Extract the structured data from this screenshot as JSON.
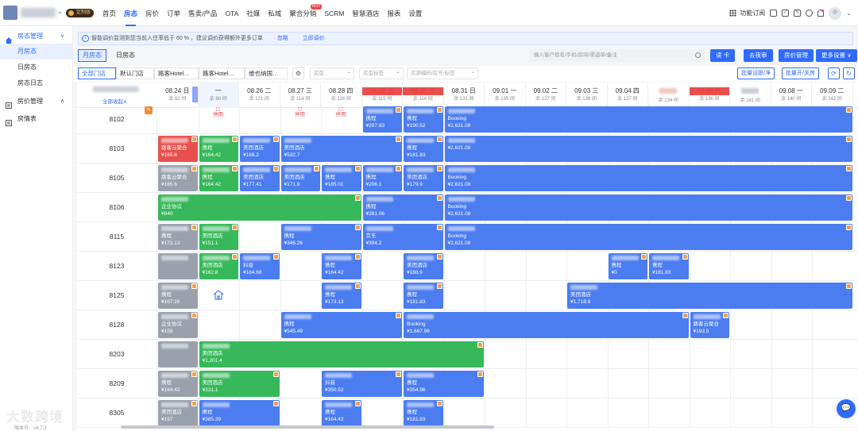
{
  "topbar": {
    "badge": "定制版",
    "nav": [
      {
        "label": "首页"
      },
      {
        "label": "房态",
        "active": true
      },
      {
        "label": "房价"
      },
      {
        "label": "订单"
      },
      {
        "label": "售卖/产品"
      },
      {
        "label": "OTA"
      },
      {
        "label": "社媒"
      },
      {
        "label": "私域"
      },
      {
        "label": "聚合分销",
        "hot": "HOT"
      },
      {
        "label": "SCRM"
      },
      {
        "label": "智慧酒店"
      },
      {
        "label": "报表"
      },
      {
        "label": "设置"
      }
    ],
    "subscribe": "功能订阅"
  },
  "sidebar": {
    "groups": [
      {
        "label": "房态管理",
        "caret": "∨",
        "icon": "home-icon",
        "items": [
          "月房态",
          "日房态",
          "房态日志"
        ],
        "active_item": 0
      },
      {
        "label": "房价管理",
        "caret": "∧",
        "icon": "price-icon",
        "items": []
      },
      {
        "label": "房情表",
        "caret": "",
        "icon": "report-icon",
        "items": []
      }
    ]
  },
  "notice": {
    "text": "智能调价监测到您当前入住率低于 60 % ，建议调价获得额外更多订单",
    "ignore": "忽略",
    "action": "立即调价"
  },
  "toolbar": {
    "view_tabs": [
      "月房态",
      "日房态"
    ],
    "search_placeholder": "输入客户姓名/手机/房间/渠道单/备注",
    "buttons": [
      "读 卡",
      "去夜审",
      "房价管理",
      "更多设置 ∨"
    ]
  },
  "filters": {
    "stores": [
      "全部门店",
      "默认门店",
      "路客Hotel…",
      "路客Hotel…",
      "维也纳国…"
    ],
    "selects": [
      "房型",
      "房型标签"
    ],
    "code_placeholder": "房源编码/房号/标签",
    "right_buttons": [
      "批量设脏/净",
      "批量开/关房"
    ]
  },
  "calendar": {
    "all_prop": "全部收起∧",
    "dates": [
      {
        "d": "08.24 日",
        "r": "余 82 间",
        "red": false
      },
      {
        "d": "一",
        "r": "余 88 间",
        "red": false,
        "today": true
      },
      {
        "d": "08.26 二",
        "r": "余 121 间",
        "red": false
      },
      {
        "d": "08.27 三",
        "r": "余 114 间",
        "red": false
      },
      {
        "d": "08.28 四",
        "r": "余 116 间",
        "red": false
      },
      {
        "d": "08.29 五",
        "r": "余 115 间",
        "red": true
      },
      {
        "d": "08.30 六",
        "r": "余 114 间",
        "red": true
      },
      {
        "d": "08.31 日",
        "r": "余 131 间",
        "red": false
      },
      {
        "d": "09.01 一",
        "r": "余 135 间",
        "red": false
      },
      {
        "d": "09.02 二",
        "r": "余 137 间",
        "red": false
      },
      {
        "d": "09.03 三",
        "r": "余 136 间",
        "red": false
      },
      {
        "d": "09.04 四",
        "r": "余 137 间",
        "red": false
      },
      {
        "d": "",
        "r": "余 134 间",
        "red": false,
        "blurred": true
      },
      {
        "d": "09.06 六",
        "r": "余 136 间",
        "red": true
      },
      {
        "d": "",
        "r": "余 141 间",
        "red": false,
        "blurred": true,
        "gray": true
      },
      {
        "d": "09.08 一",
        "r": "余 140 间",
        "red": false
      },
      {
        "d": "09.09 二",
        "r": "余 142 间",
        "red": false
      }
    ],
    "stop_label": "停用",
    "rows": [
      {
        "room": "8102",
        "stops": [
          1,
          3,
          4
        ],
        "bookings": [
          {
            "start": 5,
            "len": 1,
            "color": "blue",
            "ch": "携程",
            "pr": "¥207.93"
          },
          {
            "start": 6,
            "len": 1,
            "color": "blue",
            "ch": "携程",
            "pr": "¥190.52"
          },
          {
            "start": 7,
            "len": 10,
            "color": "blue",
            "ch": "Booking",
            "pr": "¥2,621.08"
          }
        ]
      },
      {
        "room": "8103",
        "bookings": [
          {
            "start": 0,
            "len": 1,
            "color": "red",
            "ch": "路客云聚合",
            "pr": "¥165.6"
          },
          {
            "start": 1,
            "len": 1,
            "color": "green",
            "ch": "携程",
            "pr": "¥164.42"
          },
          {
            "start": 2,
            "len": 1,
            "color": "blue",
            "ch": "美团酒店",
            "pr": "¥168.2"
          },
          {
            "start": 3,
            "len": 3,
            "color": "blue",
            "ch": "美团酒店",
            "pr": "¥532.7"
          },
          {
            "start": 6,
            "len": 1,
            "color": "blue",
            "ch": "携程",
            "pr": "¥181.83"
          },
          {
            "start": 7,
            "len": 10,
            "color": "blue",
            "ch": "",
            "pr": "¥2,621.08"
          }
        ]
      },
      {
        "room": "8105",
        "bookings": [
          {
            "start": 0,
            "len": 1,
            "color": "gray",
            "ch": "路客云聚合",
            "pr": "¥165.6"
          },
          {
            "start": 1,
            "len": 1,
            "color": "green",
            "ch": "携程",
            "pr": "¥164.42"
          },
          {
            "start": 2,
            "len": 1,
            "color": "blue",
            "ch": "美团酒店",
            "pr": "¥177.41"
          },
          {
            "start": 3,
            "len": 1,
            "color": "blue",
            "ch": "美团酒店",
            "pr": "¥171.8"
          },
          {
            "start": 4,
            "len": 1,
            "color": "blue",
            "ch": "携程",
            "pr": "¥185.01"
          },
          {
            "start": 5,
            "len": 1,
            "color": "blue",
            "ch": "携程",
            "pr": "¥206.1"
          },
          {
            "start": 6,
            "len": 1,
            "color": "blue",
            "ch": "美团酒店",
            "pr": "¥179.9"
          },
          {
            "start": 7,
            "len": 10,
            "color": "blue",
            "ch": "Booking",
            "pr": "¥2,621.08"
          }
        ]
      },
      {
        "room": "8106",
        "bookings": [
          {
            "start": 0,
            "len": 5,
            "color": "green",
            "ch": "企业协议",
            "pr": "¥840"
          },
          {
            "start": 5,
            "len": 2,
            "color": "blue",
            "ch": "携程",
            "pr": "¥381.06"
          },
          {
            "start": 7,
            "len": 10,
            "color": "blue",
            "ch": "Booking",
            "pr": "¥2,621.08"
          }
        ]
      },
      {
        "room": "8115",
        "bookings": [
          {
            "start": 0,
            "len": 1,
            "color": "gray",
            "ch": "携程",
            "pr": "¥173.13"
          },
          {
            "start": 1,
            "len": 1,
            "color": "green",
            "ch": "美团酒店",
            "pr": "¥151.1"
          },
          {
            "start": 3,
            "len": 2,
            "color": "blue",
            "ch": "携程",
            "pr": "¥346.26"
          },
          {
            "start": 5,
            "len": 2,
            "color": "blue",
            "ch": "京东",
            "pr": "¥394.2"
          },
          {
            "start": 7,
            "len": 10,
            "color": "blue",
            "ch": "Booking",
            "pr": "¥2,621.08"
          }
        ]
      },
      {
        "room": "8123",
        "bookings": [
          {
            "start": 0,
            "len": 1,
            "color": "gray",
            "ch": "",
            "pr": ""
          },
          {
            "start": 1,
            "len": 1,
            "color": "green",
            "ch": "美团酒店",
            "pr": "¥162.8"
          },
          {
            "start": 2,
            "len": 1,
            "color": "blue",
            "ch": "抖音",
            "pr": "¥164.68"
          },
          {
            "start": 4,
            "len": 1,
            "color": "blue",
            "ch": "携程",
            "pr": "¥164.42"
          },
          {
            "start": 6,
            "len": 1,
            "color": "blue",
            "ch": "美团酒店",
            "pr": "¥188.9"
          },
          {
            "start": 11,
            "len": 1,
            "color": "blue",
            "ch": "携程",
            "pr": "¥0"
          },
          {
            "start": 12,
            "len": 1,
            "color": "blue",
            "ch": "携程",
            "pr": "¥181.83"
          }
        ]
      },
      {
        "room": "8125",
        "home": 1,
        "bookings": [
          {
            "start": 0,
            "len": 1,
            "color": "gray",
            "ch": "携程",
            "pr": "¥167.26"
          },
          {
            "start": 4,
            "len": 1,
            "color": "blue",
            "ch": "携程",
            "pr": "¥173.13"
          },
          {
            "start": 6,
            "len": 1,
            "color": "blue",
            "ch": "携程",
            "pr": "¥181.83"
          },
          {
            "start": 10,
            "len": 7,
            "color": "blue",
            "ch": "美团酒店",
            "pr": "¥1,718.9"
          }
        ]
      },
      {
        "room": "8128",
        "bookings": [
          {
            "start": 0,
            "len": 1,
            "color": "gray",
            "ch": "企业协议",
            "pr": "¥159"
          },
          {
            "start": 3,
            "len": 3,
            "color": "blue",
            "ch": "携程",
            "pr": "¥545.49"
          },
          {
            "start": 6,
            "len": 7,
            "color": "blue",
            "ch": "Booking",
            "pr": "¥1,667.96"
          },
          {
            "start": 13,
            "len": 1,
            "color": "blue",
            "ch": "路客云聚合",
            "pr": "¥193.5"
          }
        ]
      },
      {
        "room": "8203",
        "bookings": [
          {
            "start": 0,
            "len": 1,
            "color": "gray",
            "ch": "",
            "pr": ""
          },
          {
            "start": 1,
            "len": 7,
            "color": "green",
            "ch": "美团酒店",
            "pr": "¥1,201.4"
          }
        ]
      },
      {
        "room": "8209",
        "bookings": [
          {
            "start": 0,
            "len": 1,
            "color": "gray",
            "ch": "携程",
            "pr": "¥164.42"
          },
          {
            "start": 1,
            "len": 2,
            "color": "green",
            "ch": "美团酒店",
            "pr": "¥331.1"
          },
          {
            "start": 4,
            "len": 2,
            "color": "blue",
            "ch": "抖音",
            "pr": "¥350.52"
          },
          {
            "start": 6,
            "len": 2,
            "color": "blue",
            "ch": "携程",
            "pr": "¥354.96"
          }
        ]
      },
      {
        "room": "8305",
        "bookings": [
          {
            "start": 0,
            "len": 1,
            "color": "gray",
            "ch": "美团酒店",
            "pr": "¥197"
          },
          {
            "start": 1,
            "len": 2,
            "color": "blue",
            "ch": "携程",
            "pr": "¥385.39"
          },
          {
            "start": 4,
            "len": 1,
            "color": "blue",
            "ch": "携程",
            "pr": "¥164.42"
          },
          {
            "start": 6,
            "len": 1,
            "color": "blue",
            "ch": "携程",
            "pr": "¥181.83"
          }
        ]
      }
    ]
  },
  "watermark": "大数跨境",
  "version": "版本号：v4.7.3"
}
